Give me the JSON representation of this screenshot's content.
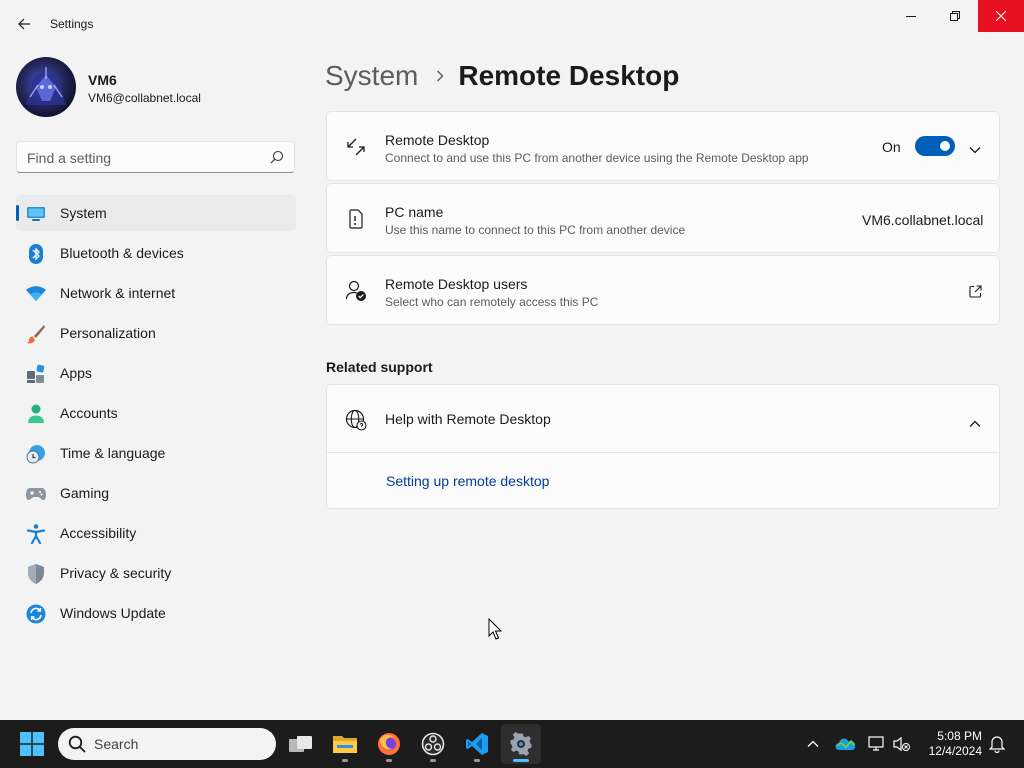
{
  "window": {
    "title": "Settings"
  },
  "profile": {
    "name": "VM6",
    "email": "VM6@collabnet.local"
  },
  "search": {
    "placeholder": "Find a setting"
  },
  "sidebar": {
    "items": [
      {
        "label": "System",
        "icon": "system-icon",
        "active": true
      },
      {
        "label": "Bluetooth & devices",
        "icon": "bluetooth-icon"
      },
      {
        "label": "Network & internet",
        "icon": "wifi-icon"
      },
      {
        "label": "Personalization",
        "icon": "brush-icon"
      },
      {
        "label": "Apps",
        "icon": "apps-icon"
      },
      {
        "label": "Accounts",
        "icon": "person-icon"
      },
      {
        "label": "Time & language",
        "icon": "clock-globe-icon"
      },
      {
        "label": "Gaming",
        "icon": "gamepad-icon"
      },
      {
        "label": "Accessibility",
        "icon": "accessibility-icon"
      },
      {
        "label": "Privacy & security",
        "icon": "shield-icon"
      },
      {
        "label": "Windows Update",
        "icon": "update-icon"
      }
    ]
  },
  "breadcrumb": {
    "parent": "System",
    "current": "Remote Desktop"
  },
  "cards": {
    "remote_desktop": {
      "title": "Remote Desktop",
      "subtitle": "Connect to and use this PC from another device using the Remote Desktop app",
      "state_label": "On",
      "enabled": true
    },
    "pc_name": {
      "title": "PC name",
      "subtitle": "Use this name to connect to this PC from another device",
      "value": "VM6.collabnet.local"
    },
    "remote_users": {
      "title": "Remote Desktop users",
      "subtitle": "Select who can remotely access this PC"
    }
  },
  "related_support": {
    "heading": "Related support",
    "help_title": "Help with Remote Desktop",
    "link": "Setting up remote desktop"
  },
  "taskbar": {
    "search_label": "Search",
    "apps": [
      "task-view",
      "file-explorer",
      "firefox",
      "obs-studio",
      "vscode",
      "settings"
    ],
    "time": "5:08 PM",
    "date": "12/4/2024"
  },
  "colors": {
    "accent": "#005fb8",
    "link": "#003e92",
    "close_button": "#e81123",
    "taskbar": "#1c1c1c"
  }
}
